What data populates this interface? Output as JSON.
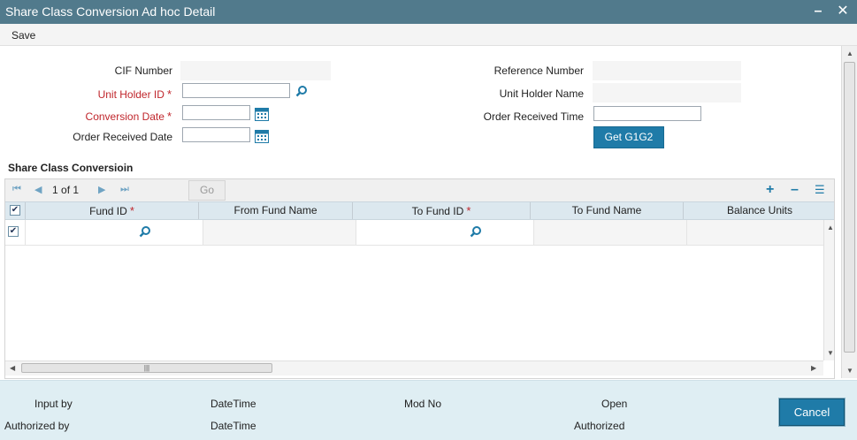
{
  "window": {
    "title": "Share Class Conversion  Ad hoc Detail",
    "minimize_glyph": "–",
    "close_glyph": "✕"
  },
  "toolbar": {
    "save_label": "Save"
  },
  "form": {
    "cif_number_label": "CIF Number",
    "cif_number_value": "",
    "unit_holder_id_label": "Unit Holder ID",
    "unit_holder_id_value": "",
    "conversion_date_label": "Conversion Date",
    "conversion_date_value": "",
    "order_received_date_label": "Order Received Date",
    "order_received_date_value": "",
    "reference_number_label": "Reference Number",
    "reference_number_value": "",
    "unit_holder_name_label": "Unit Holder Name",
    "unit_holder_name_value": "",
    "order_received_time_label": "Order Received Time",
    "order_received_time_value": "",
    "get_g1g2_label": "Get G1G2",
    "required_marker": "*"
  },
  "grid": {
    "section_title": "Share Class Conversioin",
    "pager": {
      "current": "1",
      "of_label": "of",
      "total": "1",
      "go_label": "Go"
    },
    "columns": [
      {
        "label": "Fund ID",
        "required": true
      },
      {
        "label": "From Fund Name",
        "required": false
      },
      {
        "label": "To Fund ID",
        "required": true
      },
      {
        "label": "To Fund Name",
        "required": false
      },
      {
        "label": "Balance Units",
        "required": false
      }
    ],
    "rows": [
      {
        "checked": true,
        "fund_id": "",
        "from_fund_name": "",
        "to_fund_id": "",
        "to_fund_name": "",
        "balance_units": ""
      }
    ],
    "header_checked": true
  },
  "footer": {
    "input_by_label": "Input by",
    "authorized_by_label": "Authorized by",
    "datetime_label_1": "DateTime",
    "datetime_label_2": "DateTime",
    "mod_no_label": "Mod No",
    "status_open": "Open",
    "status_authorized": "Authorized",
    "cancel_label": "Cancel"
  },
  "colors": {
    "titlebar": "#517a8c",
    "accent_button": "#1f7ba8",
    "required_label": "#c0262c",
    "footer_bg": "#dfeef3",
    "grid_header_bg": "#dce8ef"
  }
}
